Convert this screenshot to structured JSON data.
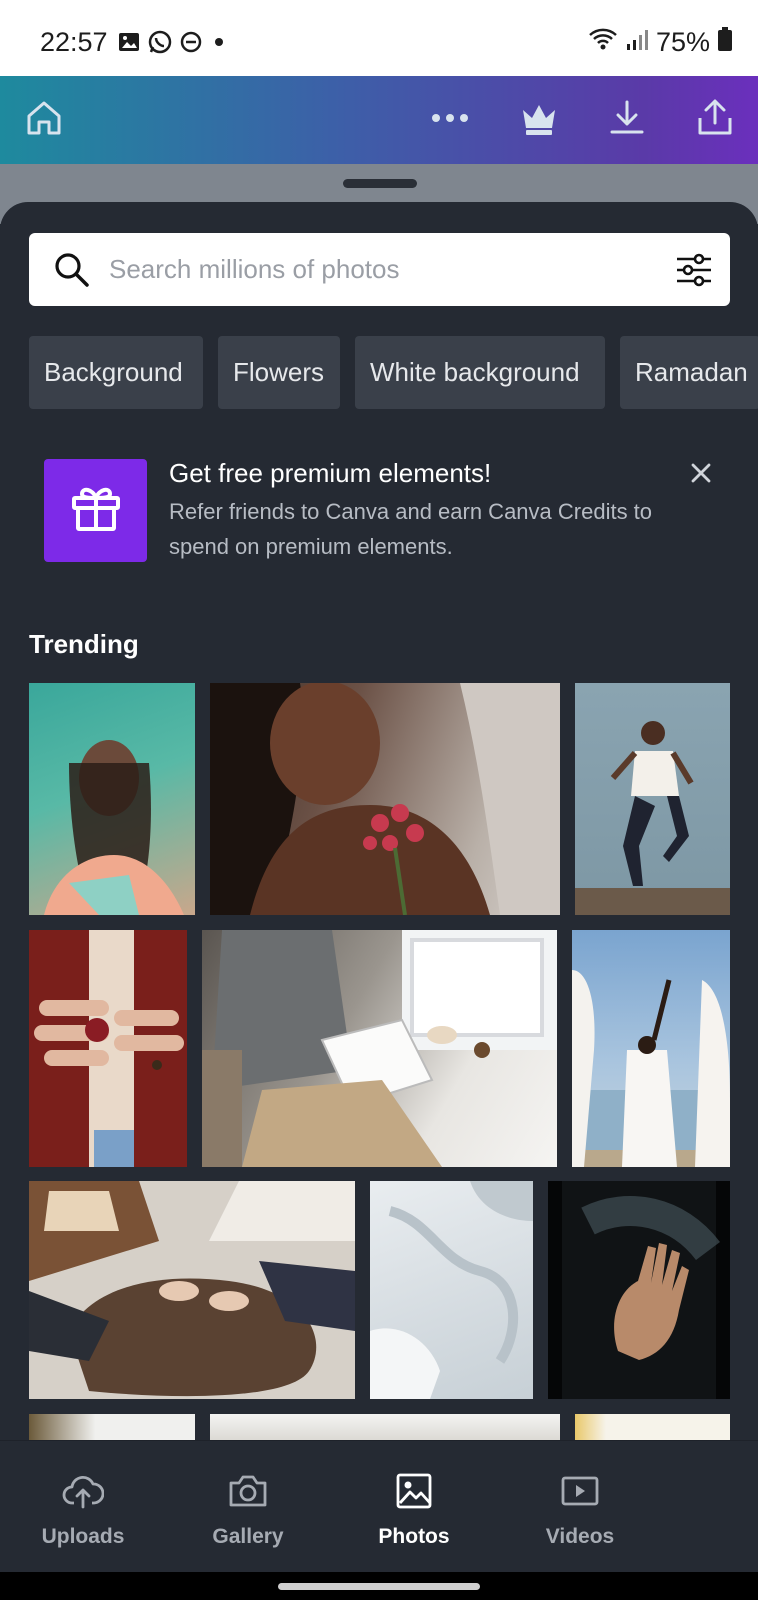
{
  "status_bar": {
    "time": "22:57",
    "battery": "75%",
    "icons": [
      "image-icon",
      "whatsapp-icon",
      "dnd-icon",
      "dot-icon",
      "wifi-icon",
      "signal-icon",
      "battery-icon"
    ]
  },
  "toolbar": {
    "icons": [
      "home-icon",
      "more-icon",
      "crown-icon",
      "download-icon",
      "share-icon"
    ]
  },
  "search": {
    "placeholder": "Search millions of photos"
  },
  "chips": [
    "Background",
    "Flowers",
    "White background",
    "Ramadan"
  ],
  "promo": {
    "title": "Get free premium elements!",
    "text": "Refer friends to Canva and earn Canva Credits to spend on premium elements."
  },
  "section": {
    "title": "Trending"
  },
  "bottom_nav": {
    "items": [
      {
        "label": "Uploads",
        "icon": "cloud-upload-icon",
        "active": false
      },
      {
        "label": "Gallery",
        "icon": "camera-icon",
        "active": false
      },
      {
        "label": "Photos",
        "icon": "image-icon",
        "active": true
      },
      {
        "label": "Videos",
        "icon": "video-icon",
        "active": false
      }
    ]
  },
  "colors": {
    "panel_bg": "#252a33",
    "chip_bg": "#3a404a",
    "accent": "#7d2ae8",
    "gradient_start": "#1e8a9e",
    "gradient_end": "#6b2fbd"
  }
}
